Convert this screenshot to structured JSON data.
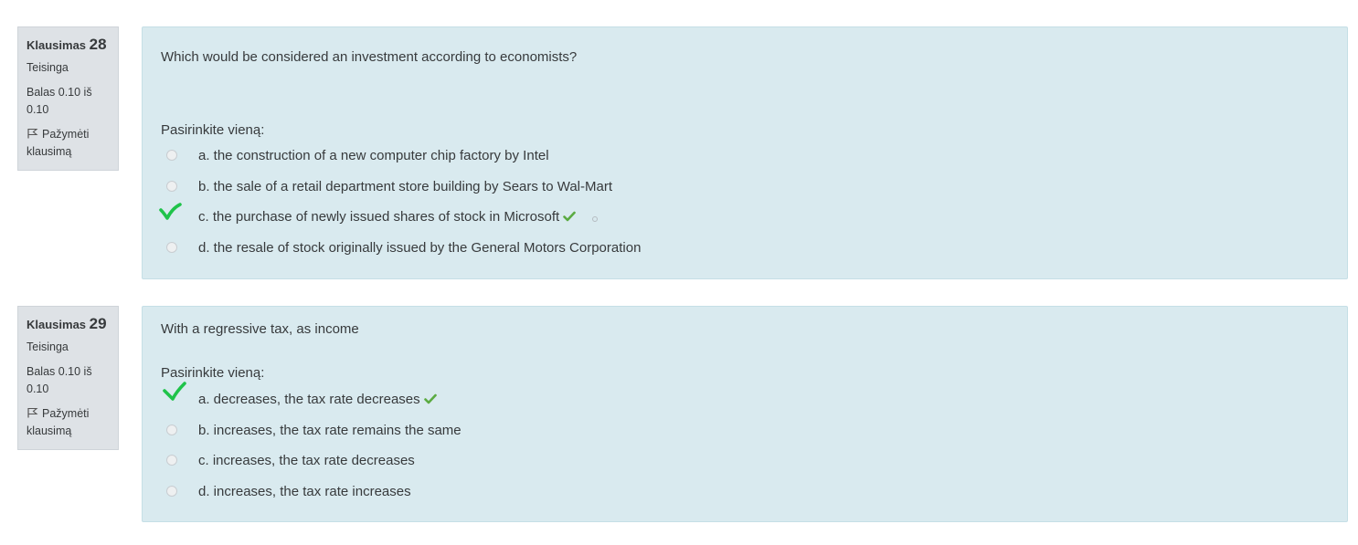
{
  "questions": [
    {
      "label": "Klausimas",
      "number": "28",
      "state": "Teisinga",
      "grade_line1": "Balas 0.10 iš",
      "grade_line2": "0.10",
      "flag_line1": "Pažymėti",
      "flag_line2": "klausimą",
      "text": "Which would be considered an investment according to economists?",
      "prompt": "Pasirinkite vieną:",
      "answers": [
        "a. the construction of a new computer chip factory by Intel",
        "b. the sale of a retail department store building by Sears to Wal-Mart",
        "c. the purchase of newly issued shares of stock in Microsoft",
        "d. the resale of stock originally issued by the General Motors Corporation"
      ],
      "selected_index": 2
    },
    {
      "label": "Klausimas",
      "number": "29",
      "state": "Teisinga",
      "grade_line1": "Balas 0.10 iš",
      "grade_line2": "0.10",
      "flag_line1": "Pažymėti",
      "flag_line2": "klausimą",
      "text": "With a regressive tax, as income",
      "prompt": "Pasirinkite vieną:",
      "answers": [
        "a. decreases, the tax rate decreases",
        "b. increases, the tax rate remains the same",
        "c. increases, the tax rate decreases",
        "d. increases, the tax rate increases"
      ],
      "selected_index": 0
    }
  ],
  "colors": {
    "content_bg": "#d9eaef",
    "info_bg": "#dee2e6",
    "correct_tick": "#5bab42",
    "hand_check": "#1fc34a"
  },
  "icons": {
    "flag": "flag-icon",
    "correct": "check-icon",
    "hand_mark": "handwritten-check-icon"
  }
}
